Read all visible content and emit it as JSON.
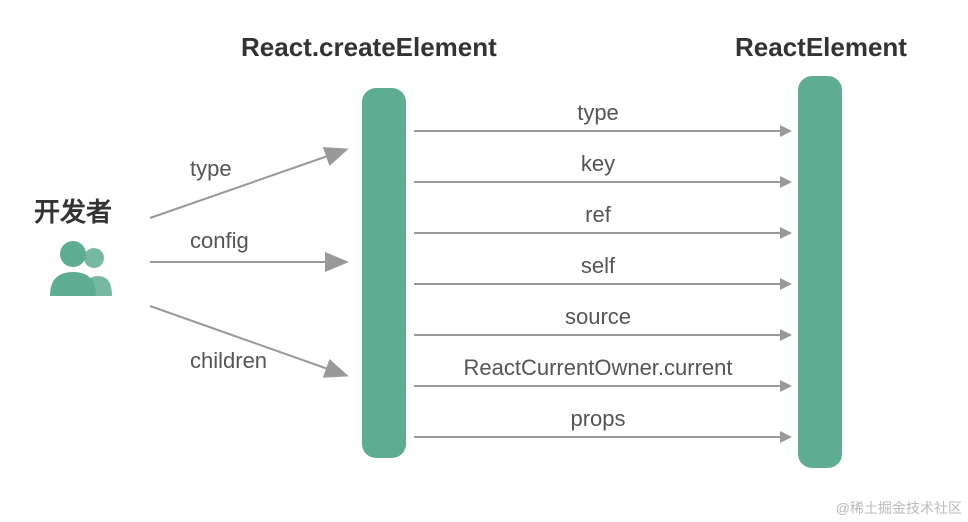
{
  "headings": {
    "developer": "开发者",
    "createElement": "React.createElement",
    "reactElement": "ReactElement"
  },
  "left_arrows": [
    "type",
    "config",
    "children"
  ],
  "mid_arrows": [
    "type",
    "key",
    "ref",
    "self",
    "source",
    "ReactCurrentOwner.current",
    "props"
  ],
  "colors": {
    "bar": "#5eac92",
    "arrow": "#999999",
    "text": "#555555",
    "heading": "#333333"
  },
  "watermark": "@稀土掘金技术社区"
}
